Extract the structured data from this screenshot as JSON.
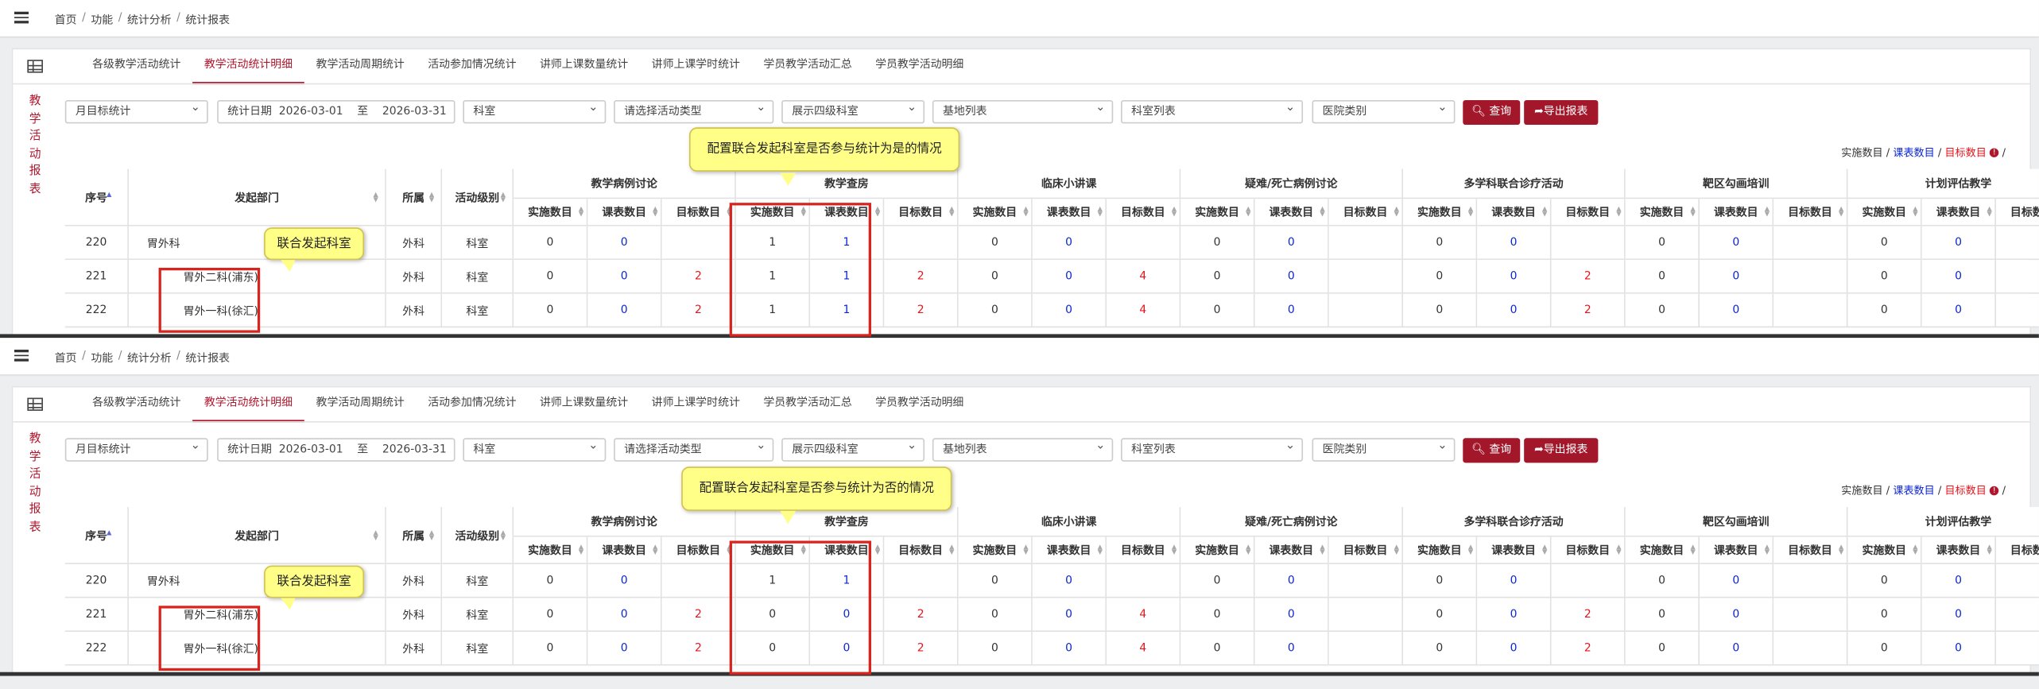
{
  "topbar": {
    "crumbs": [
      "首页",
      "功能",
      "统计分析",
      "统计报表"
    ]
  },
  "tabs": [
    "各级教学活动统计",
    "教学活动统计明细",
    "教学活动周期统计",
    "活动参加情况统计",
    "讲师上课数量统计",
    "讲师上课学时统计",
    "学员教学活动汇总",
    "学员教学活动明细"
  ],
  "active_tab": "教学活动统计明细",
  "side_title": [
    "教",
    "学",
    "活",
    "动",
    "报",
    "表"
  ],
  "filters": {
    "period": "月目标统计",
    "date_label": "统计日期",
    "date_start": "2026-03-01",
    "date_to": "至",
    "date_end": "2026-03-31",
    "dept": "科室",
    "activity_type": "请选择活动类型",
    "show_level": "展示四级科室",
    "base_list": "基地列表",
    "dept_list": "科室列表",
    "hospital_type": "医院类别"
  },
  "buttons": {
    "query": "查询",
    "export": "导出报表"
  },
  "legend": {
    "impl": "实施数目",
    "plan": "课表数目",
    "target": "目标数目",
    "slash": " / "
  },
  "table": {
    "fixed_headers": {
      "seq": "序号",
      "dept": "发起部门",
      "belong": "所属",
      "level": "活动级别"
    },
    "groups": [
      "教学病例讨论",
      "教学查房",
      "临床小讲课",
      "疑难/死亡病例讨论",
      "多学科联合诊疗活动",
      "靶区勾画培训",
      "计划评估教学"
    ],
    "sub_headers": [
      "实施数目",
      "课表数目",
      "目标数目"
    ]
  },
  "panels": [
    {
      "note": "配置联合发起科室是否参与统计为是的情况",
      "note2": "联合发起科室",
      "rows": [
        {
          "seq": "220",
          "dept": "胃外科",
          "belong": "外科",
          "level": "科室",
          "values": [
            [
              "0",
              "0",
              ""
            ],
            [
              "1",
              "1",
              ""
            ],
            [
              "0",
              "0",
              ""
            ],
            [
              "0",
              "0",
              ""
            ],
            [
              "0",
              "0",
              ""
            ],
            [
              "0",
              "0",
              ""
            ],
            [
              "0",
              "0",
              ""
            ]
          ]
        },
        {
          "seq": "221",
          "dept": "胃外二科(浦东)",
          "belong": "外科",
          "level": "科室",
          "values": [
            [
              "0",
              "0",
              "2"
            ],
            [
              "1",
              "1",
              "2"
            ],
            [
              "0",
              "0",
              "4"
            ],
            [
              "0",
              "0",
              ""
            ],
            [
              "0",
              "0",
              "2"
            ],
            [
              "0",
              "0",
              ""
            ],
            [
              "0",
              "0",
              ""
            ]
          ]
        },
        {
          "seq": "222",
          "dept": "胃外一科(徐汇)",
          "belong": "外科",
          "level": "科室",
          "values": [
            [
              "0",
              "0",
              "2"
            ],
            [
              "1",
              "1",
              "2"
            ],
            [
              "0",
              "0",
              "4"
            ],
            [
              "0",
              "0",
              ""
            ],
            [
              "0",
              "0",
              "2"
            ],
            [
              "0",
              "0",
              ""
            ],
            [
              "0",
              "0",
              ""
            ]
          ]
        }
      ]
    },
    {
      "note": "配置联合发起科室是否参与统计为否的情况",
      "note2": "联合发起科室",
      "rows": [
        {
          "seq": "220",
          "dept": "胃外科",
          "belong": "外科",
          "level": "科室",
          "values": [
            [
              "0",
              "0",
              ""
            ],
            [
              "1",
              "1",
              ""
            ],
            [
              "0",
              "0",
              ""
            ],
            [
              "0",
              "0",
              ""
            ],
            [
              "0",
              "0",
              ""
            ],
            [
              "0",
              "0",
              ""
            ],
            [
              "0",
              "0",
              ""
            ]
          ]
        },
        {
          "seq": "221",
          "dept": "胃外二科(浦东)",
          "belong": "外科",
          "level": "科室",
          "values": [
            [
              "0",
              "0",
              "2"
            ],
            [
              "0",
              "0",
              "2"
            ],
            [
              "0",
              "0",
              "4"
            ],
            [
              "0",
              "0",
              ""
            ],
            [
              "0",
              "0",
              "2"
            ],
            [
              "0",
              "0",
              ""
            ],
            [
              "0",
              "0",
              ""
            ]
          ]
        },
        {
          "seq": "222",
          "dept": "胃外一科(徐汇)",
          "belong": "外科",
          "level": "科室",
          "values": [
            [
              "0",
              "0",
              "2"
            ],
            [
              "0",
              "0",
              "2"
            ],
            [
              "0",
              "0",
              "4"
            ],
            [
              "0",
              "0",
              ""
            ],
            [
              "0",
              "0",
              "2"
            ],
            [
              "0",
              "0",
              ""
            ],
            [
              "0",
              "0",
              ""
            ]
          ]
        }
      ]
    }
  ]
}
